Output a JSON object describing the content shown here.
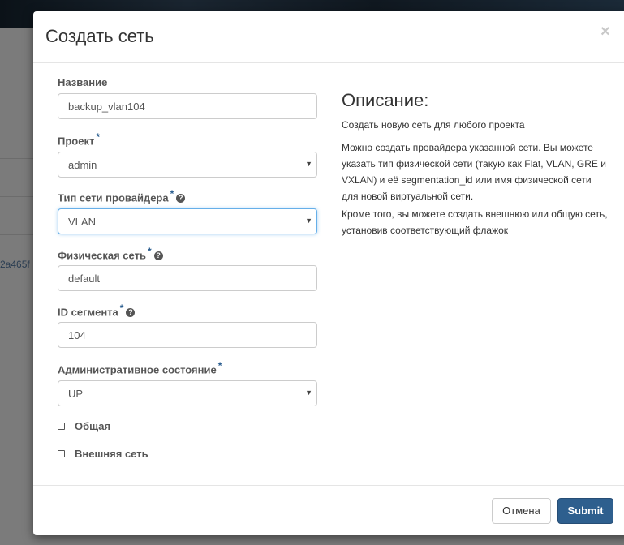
{
  "background": {
    "row_text": "2a465f"
  },
  "modal": {
    "title": "Создать сеть",
    "close_label": "×",
    "form": {
      "name": {
        "label": "Название",
        "value": "backup_vlan104"
      },
      "project": {
        "label": "Проект",
        "value": "admin"
      },
      "provider_network_type": {
        "label": "Тип сети провайдера",
        "value": "VLAN"
      },
      "physical_network": {
        "label": "Физическая сеть",
        "value": "default"
      },
      "segment_id": {
        "label": "ID сегмента",
        "value": "104"
      },
      "admin_state": {
        "label": "Административное состояние",
        "value": "UP"
      },
      "shared": {
        "label": "Общая",
        "checked": false
      },
      "external": {
        "label": "Внешняя сеть",
        "checked": false
      },
      "required_mark": "*",
      "help_glyph": "?"
    },
    "description": {
      "heading": "Описание:",
      "paragraphs": [
        "Создать новую сеть для любого проекта",
        "Можно создать провайдера указанной сети. Вы можете указать тип физической сети (такую как Flat, VLAN, GRE и VXLAN) и её segmentation_id или имя физической сети для новой виртуальной сети.",
        "Кроме того, вы можете создать внешнюю или общую сеть, установив соответствующий флажок"
      ]
    },
    "footer": {
      "cancel_label": "Отмена",
      "submit_label": "Submit"
    }
  },
  "colors": {
    "primary": "#2e5f8e",
    "required": "#2a5d8f",
    "focus": "#66afe9"
  }
}
